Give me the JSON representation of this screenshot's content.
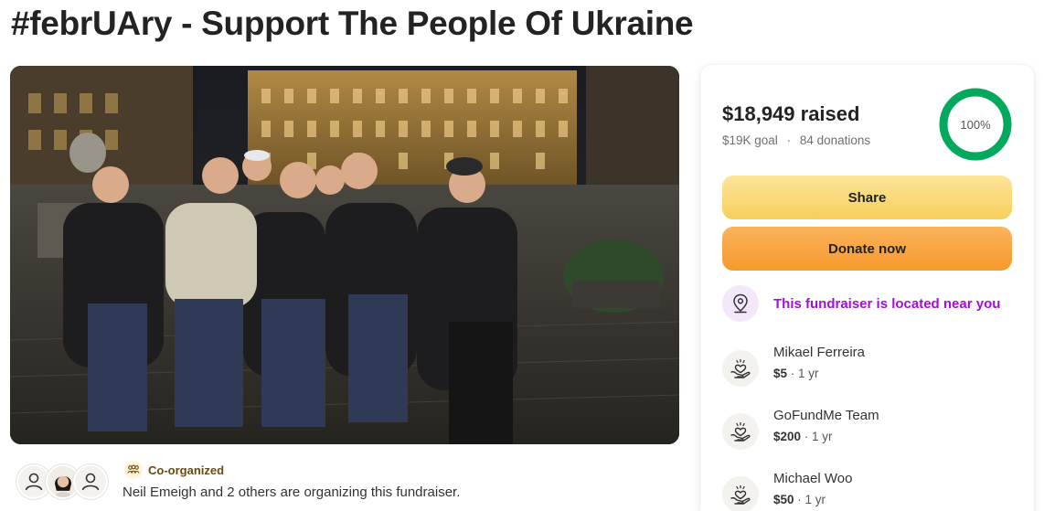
{
  "page": {
    "title": "#febrUAry - Support The People Of Ukraine"
  },
  "hero": {
    "description_icon": "group-photo"
  },
  "organizers": {
    "badge_label": "Co-organized",
    "text": "Neil Emeigh and 2 others are organizing this fundraiser."
  },
  "summary": {
    "raised": "$18,949 raised",
    "goal": "$19K goal",
    "separator": "·",
    "donations": "84 donations",
    "progress_label": "100%",
    "progress_fraction": 1.0,
    "progress_color": "#02a95c"
  },
  "actions": {
    "share_label": "Share",
    "donate_label": "Donate now"
  },
  "location": {
    "text": "This fundraiser is located near you",
    "color": "#a10fd8"
  },
  "donations": [
    {
      "name": "Mikael Ferreira",
      "amount": "$5",
      "sep": " · ",
      "time": "1 yr"
    },
    {
      "name": "GoFundMe Team",
      "amount": "$200",
      "sep": " · ",
      "time": "1 yr"
    },
    {
      "name": "Michael Woo",
      "amount": "$50",
      "sep": " · ",
      "time": "1 yr"
    }
  ]
}
